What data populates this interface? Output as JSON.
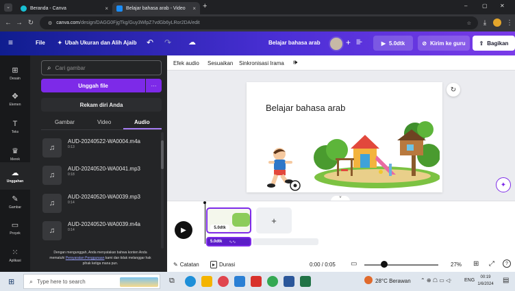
{
  "browser": {
    "tabs": [
      {
        "title": "Beranda - Canva",
        "close": "×"
      },
      {
        "title": "Belajar bahasa arab - Video",
        "close": "×"
      }
    ],
    "new_tab": "+",
    "url_host": "canva.com",
    "url_path": "/design/DAGG0FjgTkg/Guy3WlpZ7vdGb6yLRor2DA/edit",
    "window_controls": [
      "–",
      "▢",
      "✕"
    ]
  },
  "header": {
    "menu_icon": "hamburger-icon",
    "file_label": "File",
    "resize_label": "Ubah Ukuran dan Alih Ajaib",
    "design_title": "Belajar bahasa arab",
    "play_label": "5.0dtk",
    "send_label": "Kirim ke guru",
    "share_label": "Bagikan"
  },
  "rail": [
    {
      "icon": "⊞",
      "label": "Desain"
    },
    {
      "icon": "✥",
      "label": "Elemen"
    },
    {
      "icon": "T",
      "label": "Teks"
    },
    {
      "icon": "♛",
      "label": "Merek"
    },
    {
      "icon": "☁",
      "label": "Unggahan"
    },
    {
      "icon": "✎",
      "label": "Gambar"
    },
    {
      "icon": "▭",
      "label": "Proyek"
    },
    {
      "icon": "⁙",
      "label": "Aplikasi"
    }
  ],
  "panel": {
    "search_placeholder": "Cari gambar",
    "upload_label": "Unggah file",
    "upload_more": "···",
    "record_label": "Rekam diri Anda",
    "tabs": [
      "Gambar",
      "Video",
      "Audio"
    ],
    "audio_items": [
      {
        "name": "AUD-20240522-WA0004.m4a",
        "duration": "0:13"
      },
      {
        "name": "AUD-20240520-WA0041.mp3",
        "duration": "0:18"
      },
      {
        "name": "AUD-20240520-WA0039.mp3",
        "duration": "0:14"
      },
      {
        "name": "AUD-20240520-WA0039.m4a",
        "duration": "0:14"
      }
    ],
    "disclaimer_1": "Dengan mengunggah, Anda menyatakan bahwa konten Anda",
    "disclaimer_2a": "mematuhi ",
    "disclaimer_link": "Persyaratan Penggunaan",
    "disclaimer_2b": " kami dan tidak melanggar hak",
    "disclaimer_3": "pihak ketiga mana pun."
  },
  "toolbar": {
    "effect_audio": "Efek audio",
    "adjust": "Sesuaikan",
    "sync_rhythm": "Sinkronisasi Irama"
  },
  "slide": {
    "title": "Belajar bahasa arab"
  },
  "timeline": {
    "thumb_label": "5.0dtk",
    "add_page": "+",
    "audio_chip": "5.0dtk",
    "notes": "Catatan",
    "duration": "Durasi",
    "time": "0:00 / 0:05",
    "zoom": "27%"
  },
  "taskbar": {
    "search_placeholder": "Type here to search",
    "weather": "28°C  Berawan",
    "lang": "ENG",
    "time": "00:19",
    "date": "1/6/2024"
  },
  "colors": {
    "accent_purple": "#7d2ae8",
    "header_blue": "#0f1d8f",
    "panel_bg": "#242527"
  }
}
